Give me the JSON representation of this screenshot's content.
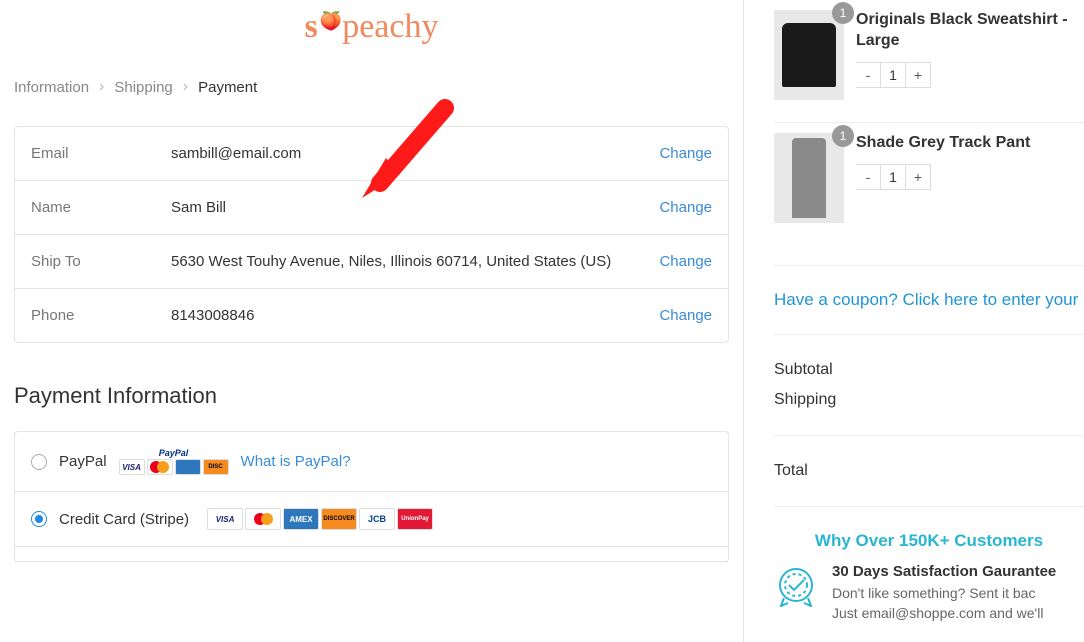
{
  "logo": {
    "part1": "s",
    "part2": "peachy"
  },
  "breadcrumbs": {
    "items": [
      {
        "label": "Information",
        "active": false
      },
      {
        "label": "Shipping",
        "active": false
      },
      {
        "label": "Payment",
        "active": true
      }
    ]
  },
  "summary": {
    "rows": [
      {
        "label": "Email",
        "value": "sambill@email.com",
        "change": "Change"
      },
      {
        "label": "Name",
        "value": "Sam Bill",
        "change": "Change"
      },
      {
        "label": "Ship To",
        "value": "5630 West Touhy Avenue, Niles, Illinois 60714, United States (US)",
        "change": "Change"
      },
      {
        "label": "Phone",
        "value": "8143008846",
        "change": "Change"
      }
    ]
  },
  "payment": {
    "title": "Payment Information",
    "options": [
      {
        "label": "PayPal",
        "help": "What is PayPal?",
        "selected": false
      },
      {
        "label": "Credit Card (Stripe)",
        "selected": true
      }
    ]
  },
  "cart": {
    "items": [
      {
        "title": "Originals Black Sweatshirt - Large",
        "qty": "1"
      },
      {
        "title": "Shade Grey Track Pant",
        "qty": "1"
      }
    ],
    "qty_minus": "-",
    "qty_plus": "+"
  },
  "coupon_text": "Have a coupon? Click here to enter your",
  "totals": {
    "subtotal_label": "Subtotal",
    "shipping_label": "Shipping",
    "total_label": "Total"
  },
  "trust": {
    "headline": "Why Over 150K+ Customers",
    "title": "30 Days Satisfaction Gaurantee",
    "line1": "Don't like something? Sent it bac",
    "line2": "Just email@shoppe.com and we'll"
  }
}
